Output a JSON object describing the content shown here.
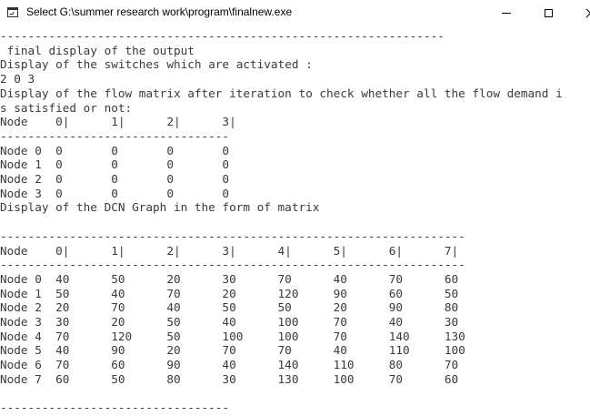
{
  "window": {
    "title": "Select G:\\summer research work\\program\\finalnew.exe",
    "controls": {
      "minimize": "minimize-icon",
      "maximize": "maximize-icon",
      "close": "close-icon"
    }
  },
  "console": {
    "lines": [
      "----------------------------------------------------------------",
      " final display of the output",
      "Display of the switches which are activated :",
      "2 0 3",
      "Display of the flow matrix after iteration to check whether all the flow demand i",
      "s satisfied or not:",
      "Node    0|      1|      2|      3|",
      "---------------------------------",
      "Node 0  0       0       0       0",
      "Node 1  0       0       0       0",
      "Node 2  0       0       0       0",
      "Node 3  0       0       0       0",
      "Display of the DCN Graph in the form of matrix",
      "",
      "-------------------------------------------------------------------",
      "Node    0|      1|      2|      3|      4|      5|      6|      7|",
      "-------------------------------------------------------------------",
      "Node 0  40      50      20      30      70      40      70      60",
      "Node 1  50      40      70      20      120     90      60      50",
      "Node 2  20      70      40      50      50      20      90      80",
      "Node 3  30      20      50      40      100     70      40      30",
      "Node 4  70      120     50      100     100     70      140     130",
      "Node 5  40      90      20      70      70      40      110     100",
      "Node 6  70      60      90      40      140     110     80      70",
      "Node 7  60      50      80      30      130     100     70      60",
      "",
      "---------------------------------"
    ]
  }
}
